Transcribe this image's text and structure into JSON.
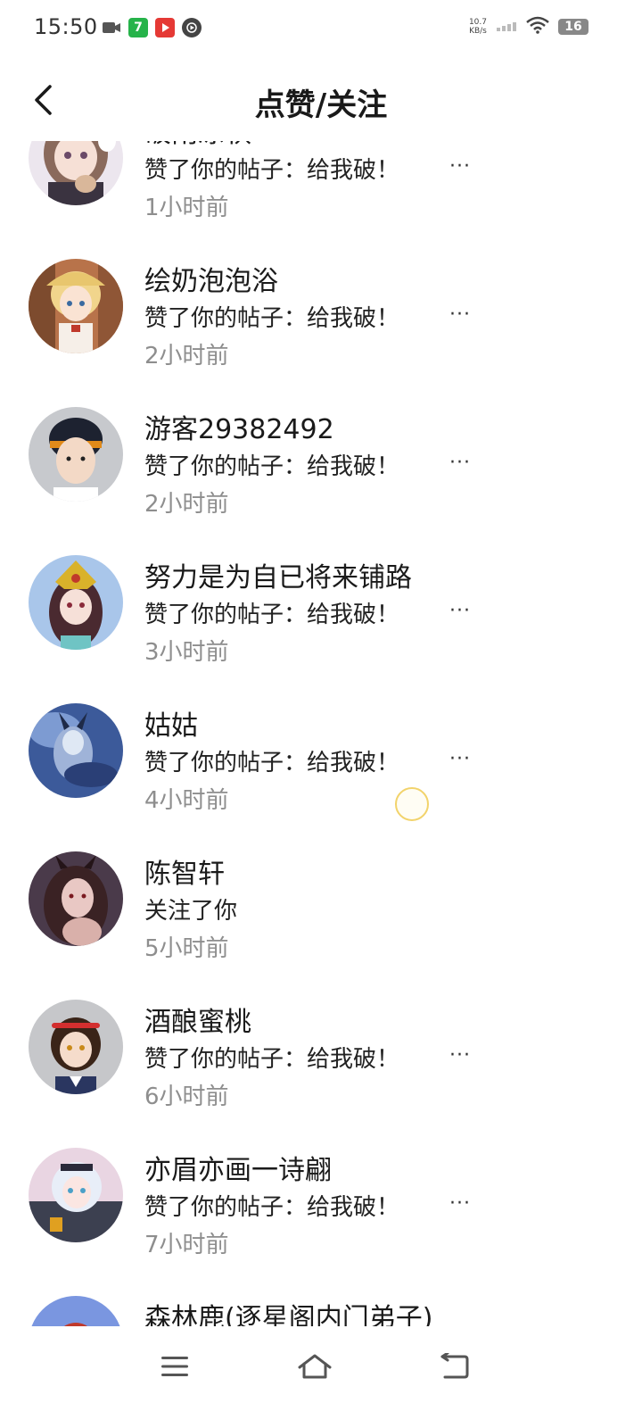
{
  "status_bar": {
    "time": "15:50",
    "net_speed_value": "10.7",
    "net_speed_unit": "KB/s",
    "battery": "16",
    "icons": [
      "video-camera-icon",
      "green-app-icon",
      "red-app-icon",
      "record-icon",
      "signal-icon",
      "wifi-icon",
      "battery-icon"
    ]
  },
  "header": {
    "title": "点赞/关注",
    "back_icon": "chevron-left-icon"
  },
  "items": [
    {
      "name": "破雨凉秋",
      "action": "赞了你的帖子：给我破！",
      "time": "1小时前",
      "has_more": true
    },
    {
      "name": "绘奶泡泡浴",
      "action": "赞了你的帖子：给我破！",
      "time": "2小时前",
      "has_more": true
    },
    {
      "name": "游客29382492",
      "action": "赞了你的帖子：给我破！",
      "time": "2小时前",
      "has_more": true
    },
    {
      "name": "努力是为自已将来铺路",
      "action": "赞了你的帖子：给我破！",
      "time": "3小时前",
      "has_more": true
    },
    {
      "name": "姑姑",
      "action": "赞了你的帖子：给我破！",
      "time": "4小时前",
      "has_more": true
    },
    {
      "name": "陈智轩",
      "action": "关注了你",
      "time": "5小时前",
      "has_more": false
    },
    {
      "name": "酒酿蜜桃",
      "action": "赞了你的帖子：给我破！",
      "time": "6小时前",
      "has_more": true
    },
    {
      "name": "亦眉亦画一诗翩",
      "action": "赞了你的帖子：给我破！",
      "time": "7小时前",
      "has_more": true
    },
    {
      "name": "森林鹿(逐星阁内门弟子)",
      "action": "",
      "time": "",
      "has_more": false
    }
  ],
  "more_label": "···",
  "nav": {
    "icons": [
      "menu-icon",
      "home-icon",
      "back-icon"
    ]
  },
  "colors": {
    "text_primary": "#1a1a1a",
    "text_secondary": "#8e8e8e",
    "background": "#ffffff"
  }
}
